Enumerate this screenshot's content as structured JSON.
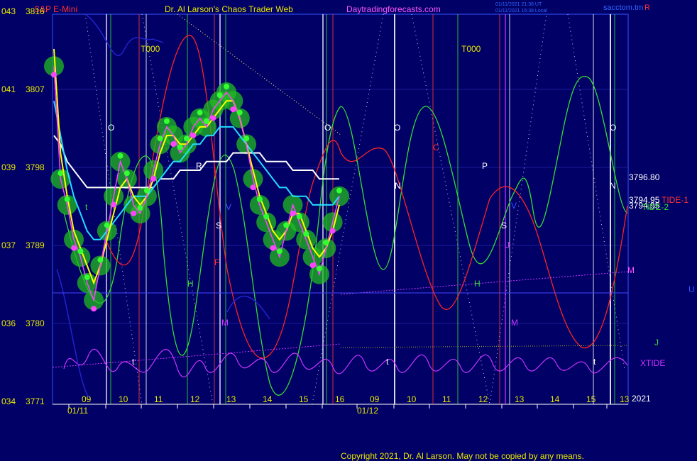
{
  "header": {
    "symbol": "S&P E-Mini",
    "title": "Dr. Al Larson's Chaos Trader Web",
    "site": "Daytradingforecasts.com",
    "timestamp1": "01/11/2021 21:38 UT",
    "timestamp2": "01/11/2021 16:38 Local",
    "brand": "sacctom.tm",
    "brand_suffix": "R"
  },
  "copyright": "Copyright 2021, Dr. Al Larson. May not be copied by any means.",
  "colors": {
    "background": "#000066",
    "price": "#ff44ff",
    "fast_ma": "#ffff00",
    "mid_ma": "#22ddff",
    "slow_ma": "#ffffff",
    "tide1": "#ff2222",
    "tide2": "#33dd33",
    "xtide": "#cc33ff",
    "cloud": "#22bb22"
  },
  "chart_data": {
    "type": "line",
    "ylim": [
      3771,
      3816
    ],
    "y_ticks": [
      {
        "left": "043",
        "right": "3816",
        "value": 3816
      },
      {
        "left": "041",
        "right": "3807",
        "value": 3807
      },
      {
        "left": "039",
        "right": "3798",
        "value": 3798
      },
      {
        "left": "037",
        "right": "3789",
        "value": 3789
      },
      {
        "left": "036",
        "right": "3780",
        "value": 3780
      },
      {
        "left": "034",
        "right": "3771",
        "value": 3771
      }
    ],
    "x_ticks": [
      "09",
      "10",
      "11",
      "12",
      "13",
      "14",
      "15",
      "16",
      "09",
      "10",
      "11",
      "12",
      "13",
      "14",
      "15",
      "13"
    ],
    "dates": [
      "01/11",
      "01/12"
    ],
    "year_label": "2021",
    "price_label": "3796.80",
    "series_labels": [
      "3794.95",
      "3794.95",
      "TIDE-1",
      "TIDE-2",
      "XTIDE"
    ],
    "markers": [
      "T000",
      "T000",
      "O",
      "O",
      "O",
      "O",
      "R",
      "P",
      "C",
      "N",
      "N",
      "S",
      "S",
      "H",
      "H",
      "M",
      "M",
      "M",
      "J",
      "J",
      "V",
      "V",
      "F",
      "t",
      "t",
      "t",
      "t",
      "U"
    ],
    "series": [
      {
        "values": [
          3810,
          3797,
          3794,
          3790,
          3788,
          3785,
          3783,
          3787,
          3791,
          3795,
          3799,
          3797,
          3794,
          3793,
          3795,
          3798,
          3801,
          3803,
          3802,
          3800,
          3801,
          3803,
          3804,
          3803,
          3805,
          3806,
          3807,
          3806,
          3804,
          3801,
          3797,
          3794,
          3792,
          3790,
          3788,
          3791,
          3794,
          3792,
          3790,
          3788,
          3786,
          3789,
          3792,
          3795
        ]
      },
      {
        "values": [
          3812,
          3800,
          3795,
          3791,
          3789,
          3787,
          3785,
          3787,
          3790,
          3793,
          3796,
          3797,
          3795,
          3794,
          3795,
          3797,
          3800,
          3802,
          3802,
          3801,
          3801,
          3802,
          3803,
          3803,
          3804,
          3805,
          3806,
          3806,
          3804,
          3801,
          3798,
          3795,
          3793,
          3791,
          3790,
          3791,
          3793,
          3793,
          3791,
          3789,
          3788,
          3789,
          3791,
          3794
        ]
      },
      {
        "values": [
          3806,
          3802,
          3798,
          3795,
          3793,
          3791,
          3790,
          3790,
          3791,
          3792,
          3793,
          3794,
          3795,
          3795,
          3795,
          3796,
          3797,
          3798,
          3799,
          3799,
          3800,
          3801,
          3801,
          3802,
          3802,
          3803,
          3803,
          3803,
          3802,
          3801,
          3800,
          3799,
          3798,
          3797,
          3796,
          3796,
          3795,
          3795,
          3795,
          3794,
          3794,
          3794,
          3794,
          3795
        ]
      },
      {
        "values": [
          3802,
          3801,
          3799,
          3798,
          3797,
          3796,
          3796,
          3796,
          3796,
          3796,
          3796,
          3796,
          3796,
          3796,
          3796,
          3796,
          3797,
          3797,
          3797,
          3798,
          3798,
          3798,
          3798,
          3799,
          3799,
          3799,
          3799,
          3800,
          3800,
          3800,
          3800,
          3800,
          3799,
          3799,
          3799,
          3799,
          3798,
          3798,
          3798,
          3798,
          3797,
          3797,
          3797,
          3797
        ]
      }
    ]
  }
}
